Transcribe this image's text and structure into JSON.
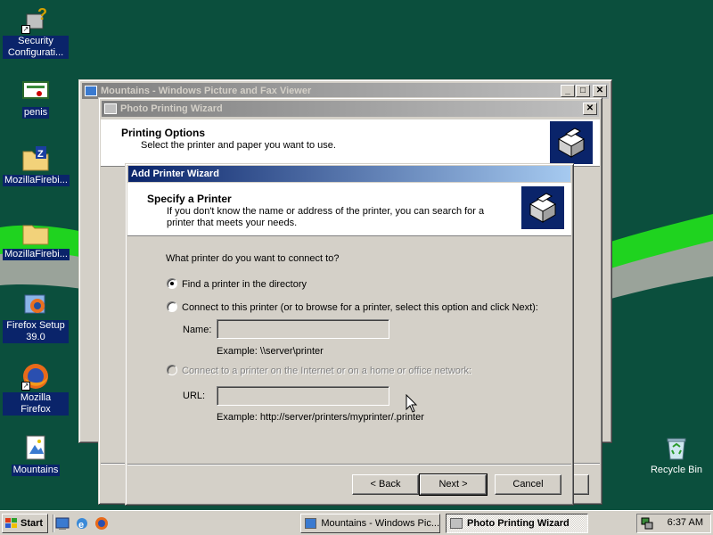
{
  "desktop": {
    "icons": [
      {
        "label": "Security Configurati...",
        "icon": "security-config-icon"
      },
      {
        "label": "penis",
        "icon": "certificate-icon"
      },
      {
        "label": "MozillaFirebi...",
        "icon": "zip-folder-icon"
      },
      {
        "label": "MozillaFirebi...",
        "icon": "folder-icon"
      },
      {
        "label": "Firefox Setup 39.0",
        "icon": "setup-installer-icon"
      },
      {
        "label": "Mozilla Firefox",
        "icon": "firefox-icon"
      },
      {
        "label": "Mountains",
        "icon": "image-file-icon"
      },
      {
        "label": "Recycle Bin",
        "icon": "recycle-bin-icon"
      }
    ]
  },
  "viewer_window": {
    "title": "Mountains - Windows Picture and Fax Viewer"
  },
  "photo_wizard": {
    "title": "Photo Printing Wizard",
    "heading": "Printing Options",
    "subheading": "Select the printer and paper you want to use."
  },
  "add_printer_wizard": {
    "title": "Add Printer Wizard",
    "heading": "Specify a Printer",
    "subheading": "If you don't know the name or address of the printer, you can search for a printer that meets your needs.",
    "question": "What printer do you want to connect to?",
    "option_find": "Find a printer in the directory",
    "option_connect": "Connect to this printer (or to browse for a printer, select this option and click Next):",
    "name_label": "Name:",
    "name_value": "",
    "name_example": "Example: \\\\server\\printer",
    "option_internet": "Connect to a printer on the Internet or on a home or office network:",
    "url_label": "URL:",
    "url_value": "",
    "url_example": "Example: http://server/printers/myprinter/.printer",
    "selected_option": "find"
  },
  "buttons": {
    "back": "< Back",
    "next": "Next >",
    "cancel": "Cancel"
  },
  "taskbar": {
    "start": "Start",
    "tasks": [
      {
        "label": "Mountains - Windows Pic...",
        "pressed": false
      },
      {
        "label": "Photo Printing Wizard",
        "pressed": true
      }
    ],
    "clock": "6:37 AM"
  }
}
